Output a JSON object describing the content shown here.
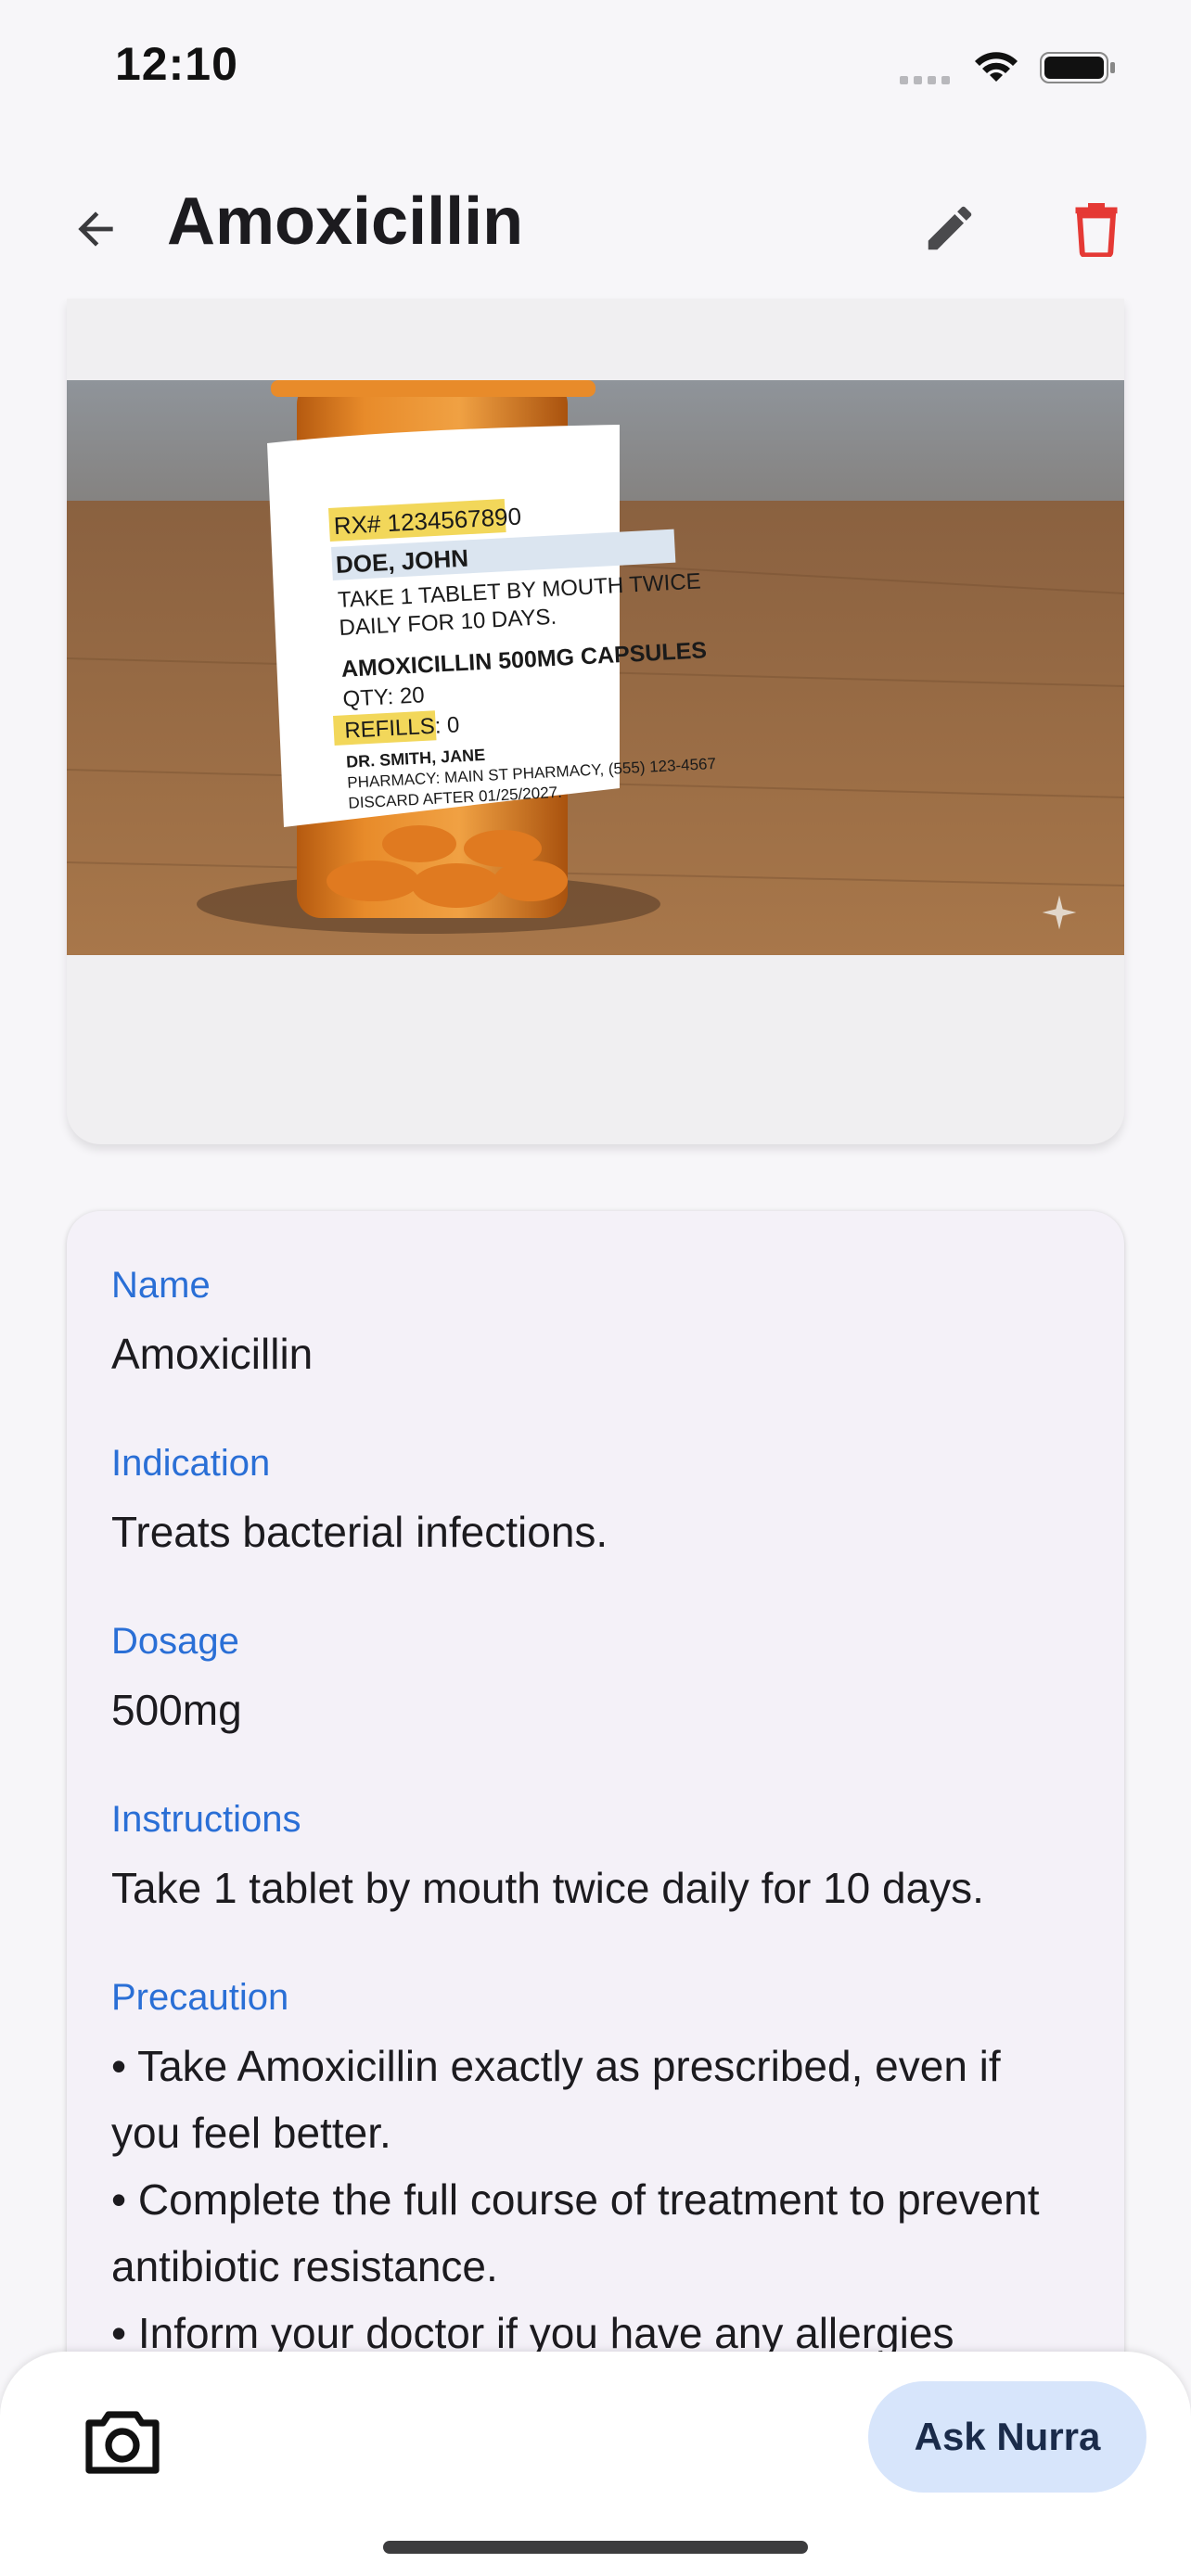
{
  "status_bar": {
    "time": "12:10"
  },
  "header": {
    "title": "Amoxicillin",
    "back_icon": "arrow-left-icon",
    "edit_icon": "pencil-icon",
    "delete_icon": "trash-icon"
  },
  "colors": {
    "accent": "#2a6fd6",
    "delete": "#e53935",
    "ask_button_bg": "#d7e5fb",
    "card_bg": "#f4f1f8"
  },
  "image": {
    "label_lines": {
      "rx": "RX# 1234567890",
      "patient": "DOE, JOHN",
      "instr1": "TAKE 1 TABLET BY MOUTH TWICE",
      "instr2": "DAILY FOR 10 DAYS.",
      "drug": "AMOXICILLIN 500MG CAPSULES",
      "qty": "QTY: 20",
      "refills": "REFILLS: 0",
      "doctor": "DR. SMITH, JANE",
      "pharmacy": "PHARMACY: MAIN ST PHARMACY, (555) 123-4567",
      "discard": "DISCARD AFTER 01/25/2027."
    }
  },
  "details": {
    "name_label": "Name",
    "name_value": "Amoxicillin",
    "indication_label": "Indication",
    "indication_value": "Treats bacterial infections.",
    "dosage_label": "Dosage",
    "dosage_value": "500mg",
    "instructions_label": "Instructions",
    "instructions_value": "Take 1 tablet by mouth twice daily for 10 days.",
    "precaution_label": "Precaution",
    "precautions": [
      "Take Amoxicillin exactly as prescribed, even if you feel better.",
      "Complete the full course of treatment to prevent antibiotic resistance.",
      "Inform your doctor if you have any allergies"
    ]
  },
  "bottom_bar": {
    "camera_icon": "camera-icon",
    "ask_label": "Ask Nurra"
  }
}
